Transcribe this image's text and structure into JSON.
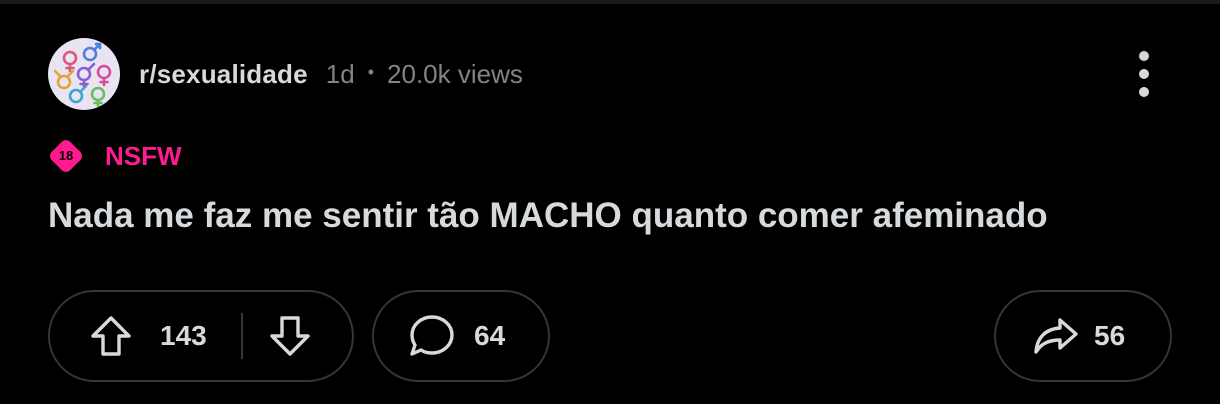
{
  "post": {
    "subreddit": "r/sexualidade",
    "age": "1d",
    "separator": "•",
    "views": "20.0k views",
    "nsfw_badge_number": "18",
    "nsfw_label": "NSFW",
    "title": "Nada me faz me sentir tão MACHO quanto comer afeminado"
  },
  "actions": {
    "upvotes": "143",
    "comments": "64",
    "shares": "56"
  },
  "icons": {
    "avatar": "gender-symbols-avatar",
    "overflow": "more-vertical-icon",
    "upvote": "arrow-up-icon",
    "downvote": "arrow-down-icon",
    "comment": "speech-bubble-icon",
    "share": "share-arrow-icon"
  },
  "colors": {
    "background": "#000000",
    "text": "#d7dadc",
    "muted": "#818384",
    "nsfw": "#ff1a8f",
    "border": "#343536"
  }
}
